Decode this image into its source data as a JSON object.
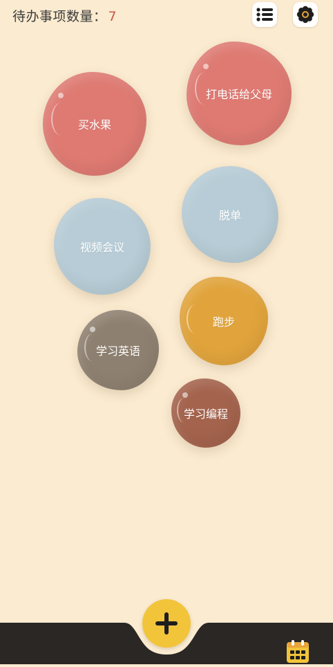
{
  "header": {
    "pending_label": "待办事项数量：",
    "pending_count": "7"
  },
  "icons": {
    "list": "list-icon",
    "settings": "gear-icon",
    "add": "plus-icon",
    "calendar": "calendar-icon"
  },
  "todos": [
    {
      "label": "买水果",
      "color": "#DE7A72"
    },
    {
      "label": "打电话给父母",
      "color": "#DE7A72"
    },
    {
      "label": "脱单",
      "color": "#B7CCD6"
    },
    {
      "label": "视频会议",
      "color": "#B7CCD6"
    },
    {
      "label": "跑步",
      "color": "#E1A43C"
    },
    {
      "label": "学习英语",
      "color": "#8E8070"
    },
    {
      "label": "学习编程",
      "color": "#A4634D"
    }
  ],
  "colors": {
    "background": "#FBEBD0",
    "bottom_bar": "#2A2724",
    "accent_add": "#F2C43A",
    "count_color": "#C9584C",
    "calendar": "#F2C43A"
  }
}
